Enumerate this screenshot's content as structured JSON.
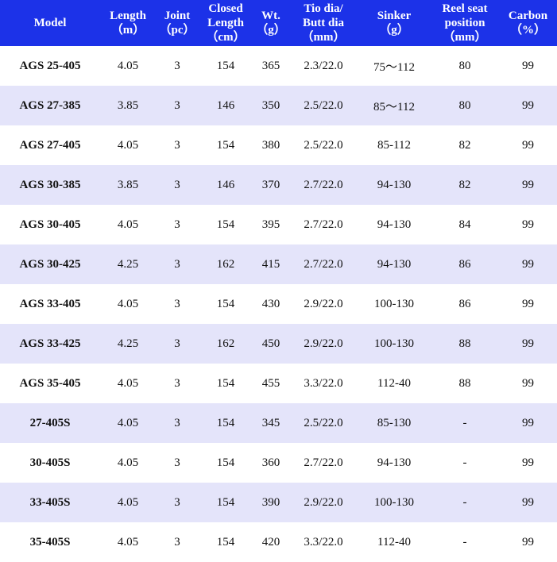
{
  "table": {
    "headers": [
      {
        "key": "model",
        "lines": [
          "Model"
        ]
      },
      {
        "key": "length",
        "lines": [
          "Length",
          "（m）"
        ]
      },
      {
        "key": "joint",
        "lines": [
          "Joint",
          "（pc）"
        ]
      },
      {
        "key": "closed_length",
        "lines": [
          "Closed",
          "Length",
          "（cm）"
        ]
      },
      {
        "key": "weight",
        "lines": [
          "Wt.",
          "（g）"
        ]
      },
      {
        "key": "tip_butt_dia",
        "lines": [
          "Tio dia/",
          "Butt dia",
          "（mm）"
        ]
      },
      {
        "key": "sinker",
        "lines": [
          "Sinker",
          "（g）"
        ]
      },
      {
        "key": "reel_seat_position",
        "lines": [
          "Reel seat",
          "position",
          "（mm）"
        ]
      },
      {
        "key": "carbon",
        "lines": [
          "Carbon",
          "（%）"
        ]
      }
    ],
    "rows": [
      [
        "AGS 25-405",
        "4.05",
        "3",
        "154",
        "365",
        "2.3/22.0",
        "75～112",
        "80",
        "99"
      ],
      [
        "AGS 27-385",
        "3.85",
        "3",
        "146",
        "350",
        "2.5/22.0",
        "85～112",
        "80",
        "99"
      ],
      [
        "AGS 27-405",
        "4.05",
        "3",
        "154",
        "380",
        "2.5/22.0",
        "85-112",
        "82",
        "99"
      ],
      [
        "AGS 30-385",
        "3.85",
        "3",
        "146",
        "370",
        "2.7/22.0",
        "94-130",
        "82",
        "99"
      ],
      [
        "AGS 30-405",
        "4.05",
        "3",
        "154",
        "395",
        "2.7/22.0",
        "94-130",
        "84",
        "99"
      ],
      [
        "AGS 30-425",
        "4.25",
        "3",
        "162",
        "415",
        "2.7/22.0",
        "94-130",
        "86",
        "99"
      ],
      [
        "AGS 33-405",
        "4.05",
        "3",
        "154",
        "430",
        "2.9/22.0",
        "100-130",
        "86",
        "99"
      ],
      [
        "AGS 33-425",
        "4.25",
        "3",
        "162",
        "450",
        "2.9/22.0",
        "100-130",
        "88",
        "99"
      ],
      [
        "AGS 35-405",
        "4.05",
        "3",
        "154",
        "455",
        "3.3/22.0",
        "112-40",
        "88",
        "99"
      ],
      [
        "27-405S",
        "4.05",
        "3",
        "154",
        "345",
        "2.5/22.0",
        "85-130",
        "-",
        "99"
      ],
      [
        "30-405S",
        "4.05",
        "3",
        "154",
        "360",
        "2.7/22.0",
        "94-130",
        "-",
        "99"
      ],
      [
        "33-405S",
        "4.05",
        "3",
        "154",
        "390",
        "2.9/22.0",
        "100-130",
        "-",
        "99"
      ],
      [
        "35-405S",
        "4.05",
        "3",
        "154",
        "420",
        "3.3/22.0",
        "112-40",
        "-",
        "99"
      ]
    ]
  },
  "colors": {
    "header_bg": "#1c32e8",
    "header_text": "#ffffff",
    "row_alt_bg": "#e4e4fa",
    "row_bg": "#ffffff"
  }
}
